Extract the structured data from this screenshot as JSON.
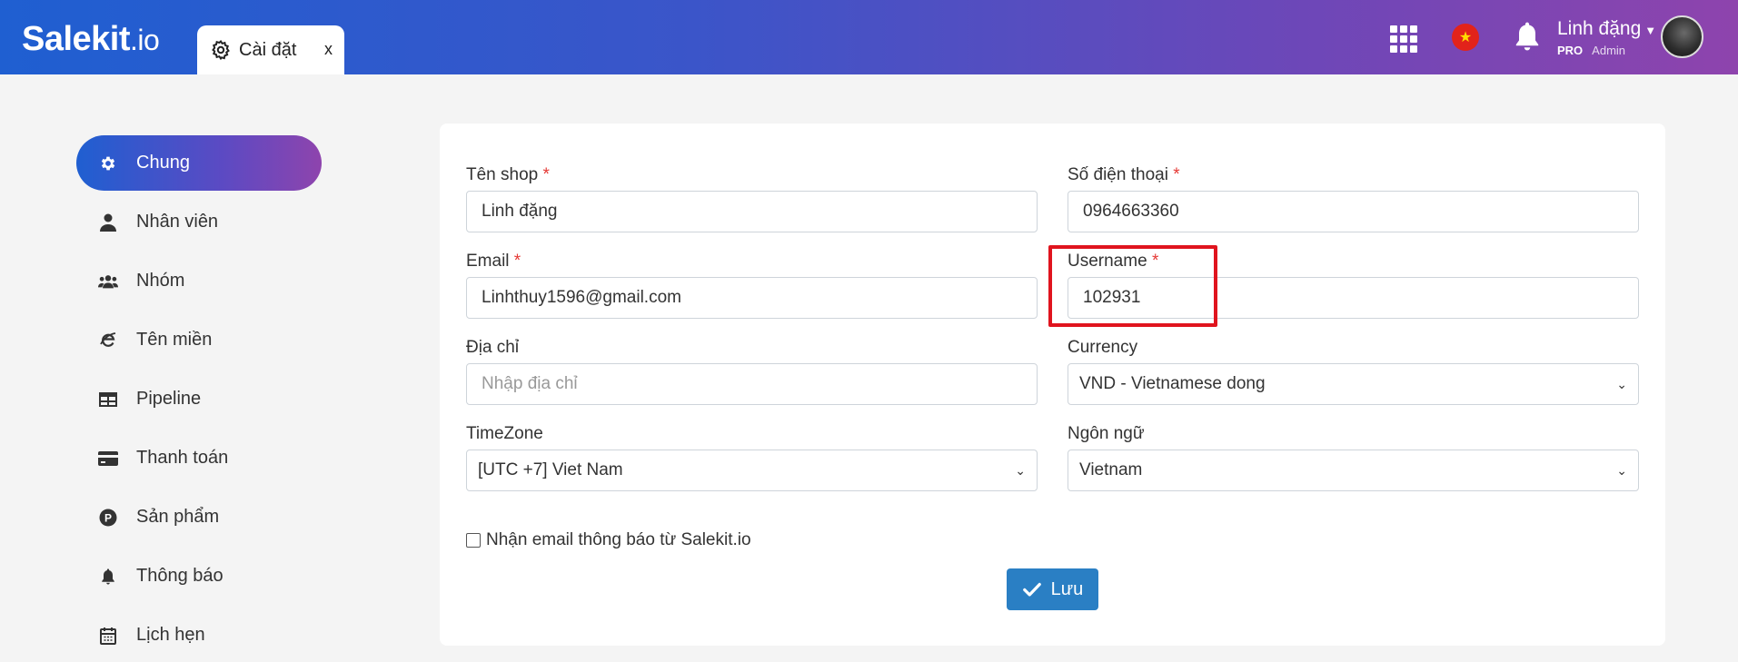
{
  "app": {
    "logo_main": "Salekit",
    "logo_suffix": ".io"
  },
  "tab": {
    "label": "Cài đặt",
    "close": "x"
  },
  "header": {
    "user_name": "Linh đặng",
    "plan": "PRO",
    "role": "Admin",
    "flag_star": "★"
  },
  "sidebar": {
    "items": [
      {
        "label": "Chung",
        "icon": "gear-icon",
        "active": true
      },
      {
        "label": "Nhân viên",
        "icon": "user-icon"
      },
      {
        "label": "Nhóm",
        "icon": "users-icon"
      },
      {
        "label": "Tên miền",
        "icon": "globe-icon"
      },
      {
        "label": "Pipeline",
        "icon": "table-icon"
      },
      {
        "label": "Thanh toán",
        "icon": "credit-card-icon"
      },
      {
        "label": "Sản phẩm",
        "icon": "product-icon"
      },
      {
        "label": "Thông báo",
        "icon": "bell-icon"
      },
      {
        "label": "Lịch hẹn",
        "icon": "calendar-icon"
      }
    ]
  },
  "form": {
    "shop_name": {
      "label": "Tên shop",
      "required": "*",
      "value": "Linh đặng"
    },
    "phone": {
      "label": "Số điện thoại",
      "required": "*",
      "value": "0964663360"
    },
    "email": {
      "label": "Email",
      "required": "*",
      "value": "Linhthuy1596@gmail.com"
    },
    "username": {
      "label": "Username",
      "required": "*",
      "value": "102931"
    },
    "address": {
      "label": "Địa chỉ",
      "placeholder": "Nhập địa chỉ"
    },
    "currency": {
      "label": "Currency",
      "selected": "VND - Vietnamese dong"
    },
    "timezone": {
      "label": "TimeZone",
      "selected": "[UTC +7] Viet Nam"
    },
    "language": {
      "label": "Ngôn ngữ",
      "selected": "Vietnam"
    },
    "email_notify": {
      "label": "Nhận email thông báo từ Salekit.io",
      "checked": false
    },
    "save_label": "Lưu"
  },
  "colors": {
    "header_start": "#1f5fd1",
    "header_end": "#8e44ad",
    "save_button": "#2a7fc4",
    "highlight": "#e0141e",
    "required": "#e53935"
  }
}
